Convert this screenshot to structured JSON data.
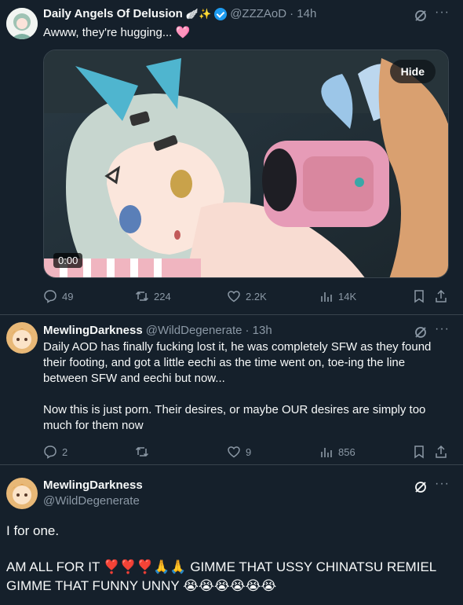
{
  "tweet1": {
    "name": "Daily Angels Of Delusion",
    "name_emoji": "🪽✨",
    "handle": "@ZZZAoD",
    "time": "· 14h",
    "text": "Awww, they're hugging... 🩷",
    "media": {
      "hide_label": "Hide",
      "time_label": "0:00"
    },
    "actions": {
      "replies": "49",
      "reposts": "224",
      "likes": "2.2K",
      "views": "14K"
    }
  },
  "tweet2": {
    "name": "MewlingDarkness",
    "handle": "@WildDegenerate",
    "time": "· 13h",
    "text_p1_l1": "Daily AOD has finally fucking lost it, he was completely SFW as they found",
    "text_p1_l2": "their footing, and got a little eechi as the time went on, toe-ing the line",
    "text_p1_l3": "between SFW and eechi but now...",
    "text_p2_l1": "Now this is just porn. Their desires, or maybe OUR desires are simply too",
    "text_p2_l2": "much for them now",
    "actions": {
      "replies": "2",
      "reposts": "",
      "likes": "9",
      "views": "856"
    }
  },
  "tweet3": {
    "name": "MewlingDarkness",
    "handle": "@WildDegenerate",
    "line1": "I for one.",
    "line2": "AM ALL FOR IT ❣️❣️❣️🙏🙏 GIMME THAT USSY CHINATSU REMIEL",
    "line3": "GIMME THAT FUNNY UNNY 😭😭😭😭😭😭"
  },
  "icons": {
    "reply": "reply-icon",
    "repost": "repost-icon",
    "like": "like-icon",
    "views": "views-icon",
    "bookmark": "bookmark-icon",
    "share": "share-icon",
    "grok": "grok-icon",
    "more": "more-icon"
  },
  "colors": {
    "background": "#15202b",
    "muted": "#8b98a5",
    "accent": "#1d9bf0"
  }
}
